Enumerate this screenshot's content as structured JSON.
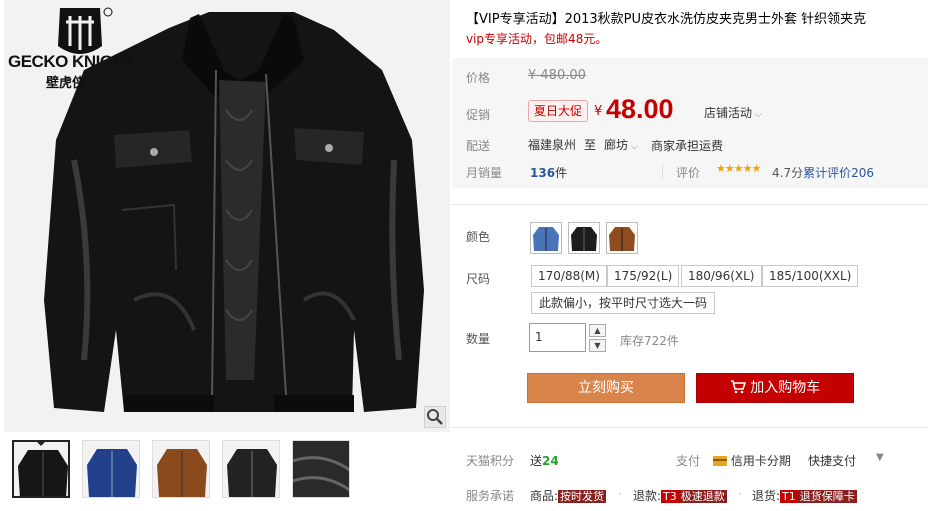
{
  "brand": {
    "name": "GECKO KNIGHT",
    "name_cn": "壁虎侠"
  },
  "product": {
    "title": "【VIP专享活动】2013秋款PU皮衣水洗仿皮夹克男士外套 针织领夹克",
    "subtitle": "vip专享活动，包邮48元。"
  },
  "price": {
    "label": "价格",
    "original": "¥ 480.00",
    "promo_label": "促销",
    "promo_tag": "夏日大促",
    "currency": "¥",
    "current": "48.00",
    "store_promo": "店铺活动"
  },
  "shipping": {
    "label": "配送",
    "from": "福建泉州",
    "to_label": "至",
    "to": "廊坊",
    "fee": "商家承担运费"
  },
  "sales": {
    "label": "月销量",
    "count": "136",
    "unit": "件",
    "review_label": "评价",
    "stars": "★★★★★",
    "score": "4.7分",
    "reviews_text": "累计评价206"
  },
  "sku": {
    "color_label": "颜色",
    "colors": [
      "blue-jacket",
      "black-jacket",
      "brown-jacket"
    ],
    "size_label": "尺码",
    "sizes": [
      "170/88(M)",
      "175/92(L)",
      "180/96(XL)",
      "185/100(XXL)"
    ],
    "size_note": "此款偏小，按平时尺寸选大一码",
    "qty_label": "数量",
    "qty_value": "1",
    "stock": "库存722件"
  },
  "actions": {
    "buy": "立刻购买",
    "cart": "加入购物车"
  },
  "extra": {
    "points_label": "天猫积分",
    "points_text": "送",
    "points_value": "24",
    "pay_label": "支付",
    "pay_card": "信用卡分期",
    "fast_pay": "快捷支付",
    "service_label": "服务承诺",
    "service_goods": "商品:",
    "service_goods_tag": "按时发货",
    "service_refund": "退款:",
    "service_refund_tag": "T3",
    "service_refund_text": "极速退款",
    "service_return": "退货:",
    "service_return_tag": "T1",
    "service_return_text": "退货保障卡"
  },
  "colors": {
    "price_red": "#c40000",
    "buy_orange": "#d9844a",
    "cart_red": "#c40000",
    "link_blue": "#2955a5"
  },
  "thumbnails": [
    "black-front",
    "blue-front",
    "brown-front",
    "black-front-2",
    "detail-closeup"
  ]
}
